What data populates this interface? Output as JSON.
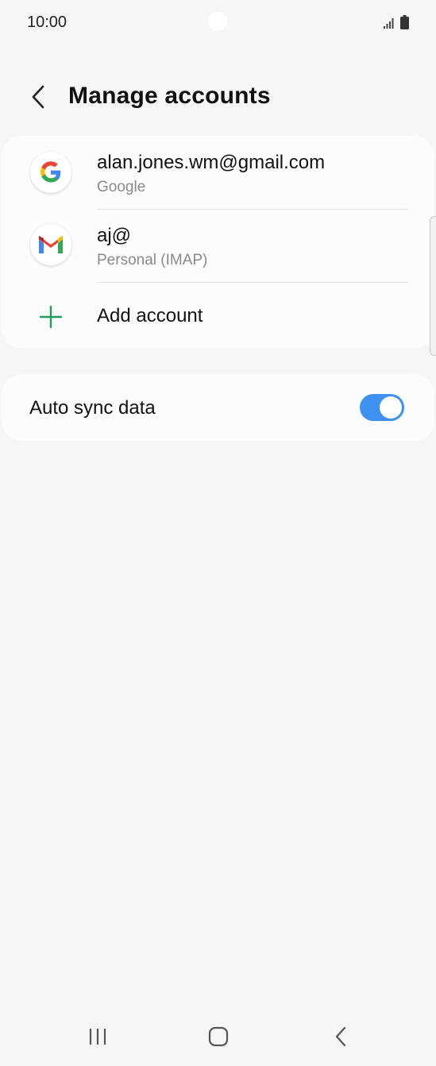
{
  "status_bar": {
    "time": "10:00",
    "icons": [
      "signal-icon",
      "battery-icon"
    ]
  },
  "header": {
    "title": "Manage accounts",
    "back_icon": "chevron-left-icon"
  },
  "accounts": [
    {
      "title": "alan.jones.wm@gmail.com",
      "subtitle": "Google",
      "icon": "google-icon"
    },
    {
      "title": "aj@",
      "subtitle": "Personal (IMAP)",
      "icon": "gmail-icon"
    }
  ],
  "add_account": {
    "label": "Add account",
    "icon": "plus-icon",
    "color": "#1f9d63"
  },
  "sync": {
    "label": "Auto sync data",
    "enabled": true,
    "accent": "#3e91f0"
  },
  "nav_bar": {
    "buttons": [
      "recents-icon",
      "home-icon",
      "back-icon"
    ]
  }
}
